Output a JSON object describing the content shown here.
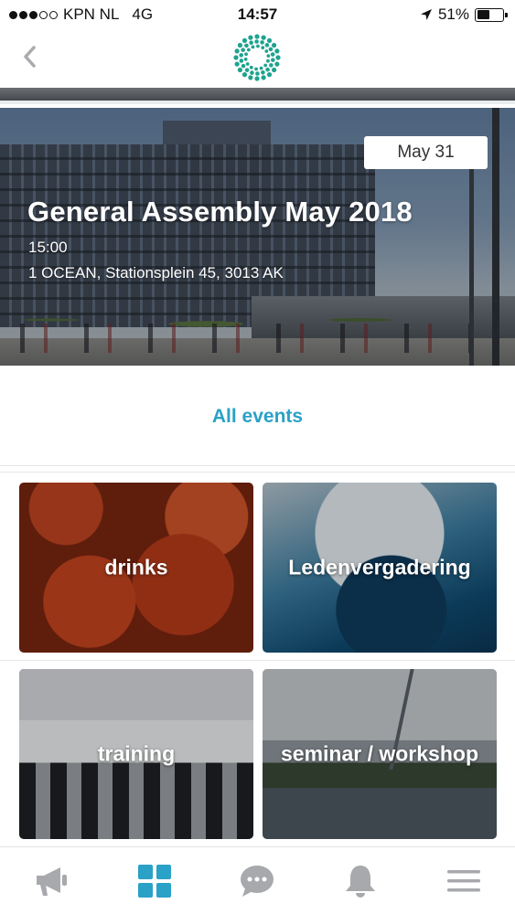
{
  "status_bar": {
    "carrier": "KPN NL",
    "network": "4G",
    "time": "14:57",
    "battery": "51%",
    "battery_level": 0.51,
    "signal_bars_filled": 3,
    "signal_bars_total": 5
  },
  "nav": {
    "back_icon": "chevron-left-icon",
    "logo": "circular-dots-logo"
  },
  "featured_event": {
    "date": "May 31",
    "title": "General Assembly May 2018",
    "time": "15:00",
    "location": "1 OCEAN, Stationsplein 45, 3013 AK"
  },
  "all_events_link": "All events",
  "categories": [
    {
      "label": "drinks"
    },
    {
      "label": "Ledenvergadering"
    },
    {
      "label": "training"
    },
    {
      "label": "seminar / workshop"
    }
  ],
  "tab_bar": {
    "tabs": [
      {
        "icon": "megaphone-icon",
        "active": false
      },
      {
        "icon": "grid-icon",
        "active": true
      },
      {
        "icon": "chat-bubble-icon",
        "active": false
      },
      {
        "icon": "bell-icon",
        "active": false
      },
      {
        "icon": "menu-icon",
        "active": false
      }
    ]
  },
  "colors": {
    "accent": "#2aa1c7",
    "inactive_icon": "#a7a9ac",
    "logo": "#1ea38f"
  }
}
